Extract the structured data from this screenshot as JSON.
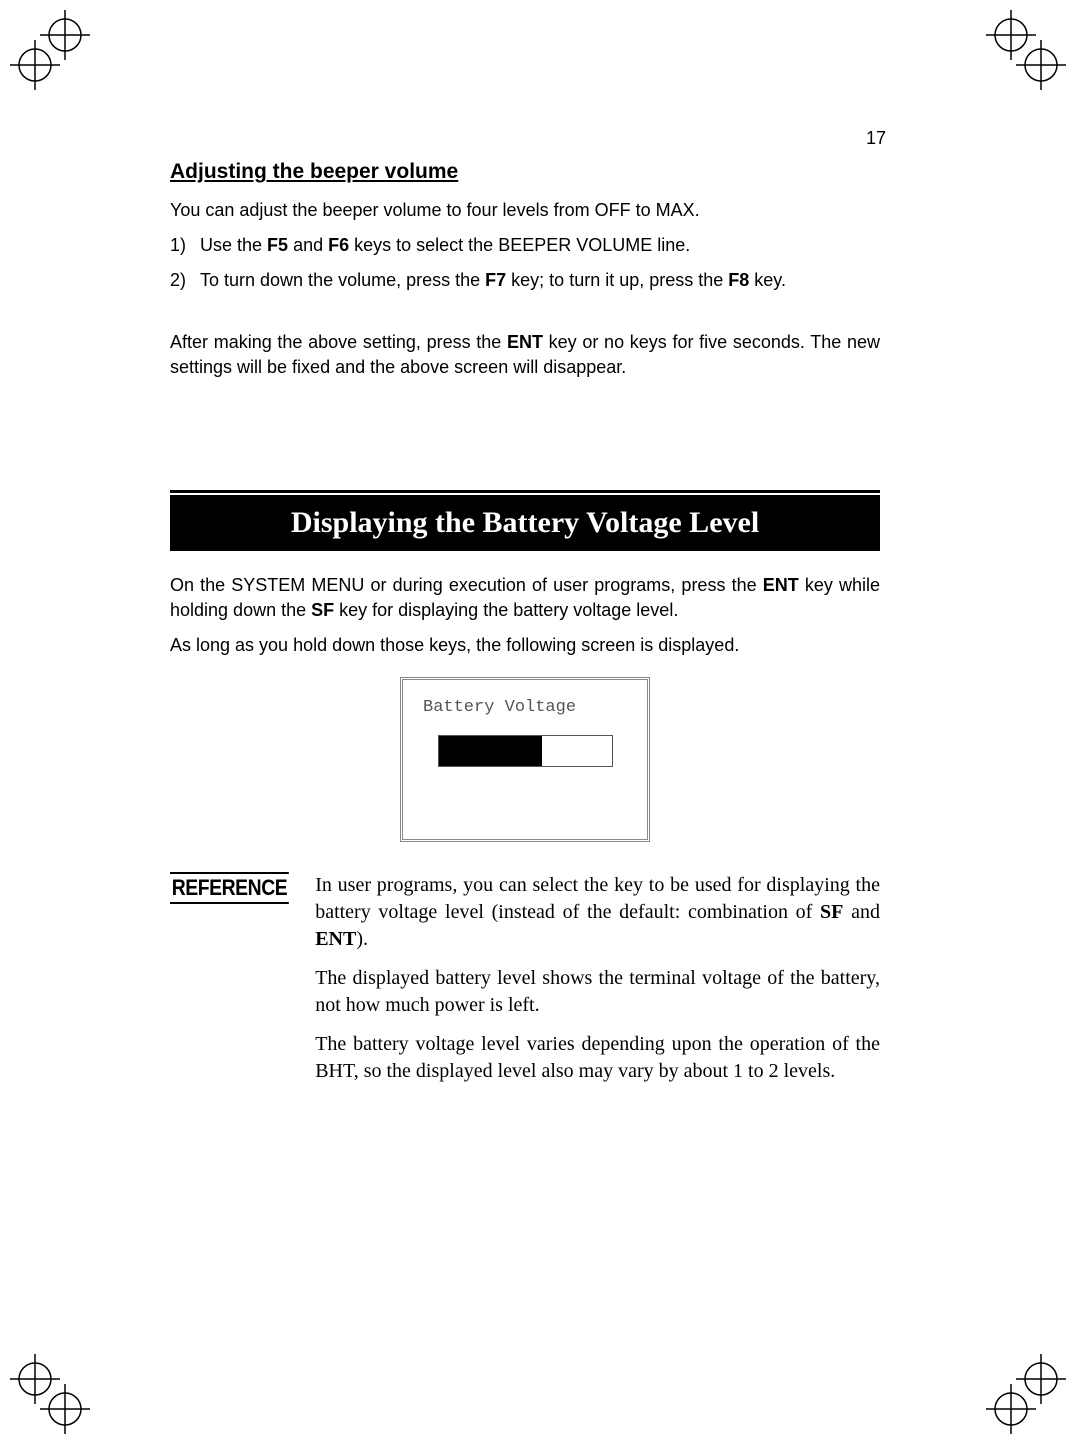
{
  "page_number": "17",
  "section1": {
    "heading": "Adjusting the beeper volume",
    "intro": "You can adjust the beeper volume to four levels from OFF to MAX.",
    "steps": [
      {
        "num": "1)",
        "pre": "Use the ",
        "b1": "F5",
        "mid1": " and ",
        "b2": "F6",
        "post": " keys to select the BEEPER VOLUME line."
      },
      {
        "num": "2)",
        "pre": "To turn down the volume, press the ",
        "b1": "F7",
        "mid1": " key; to turn it up, press the ",
        "b2": "F8",
        "post": " key."
      }
    ],
    "after_pre": "After making the above setting, press the ",
    "after_b": "ENT",
    "after_post": " key or no keys for five seconds. The new settings will be fixed and the above screen will disappear."
  },
  "banner": "Displaying the Battery Voltage Level",
  "section2": {
    "p1_pre": "On the SYSTEM MENU or during execution of user programs, press the ",
    "p1_b1": "ENT",
    "p1_mid": " key while holding down the ",
    "p1_b2": "SF",
    "p1_post": " key for displaying the battery voltage level.",
    "p2": "As long as you hold down those keys, the following screen is displayed."
  },
  "display": {
    "label": "Battery Voltage"
  },
  "reference": {
    "label": "REFERENCE",
    "p1_pre": "In user programs, you can select the key to be used for displaying the battery voltage level (instead of the default: combination of ",
    "p1_b1": "SF",
    "p1_mid": " and ",
    "p1_b2": "ENT",
    "p1_post": ").",
    "p2": "The displayed battery level shows the terminal voltage of the battery, not how much power is left.",
    "p3": "The battery voltage level varies depending upon the operation of the BHT, so the displayed level also may vary by about 1 to 2 levels."
  }
}
